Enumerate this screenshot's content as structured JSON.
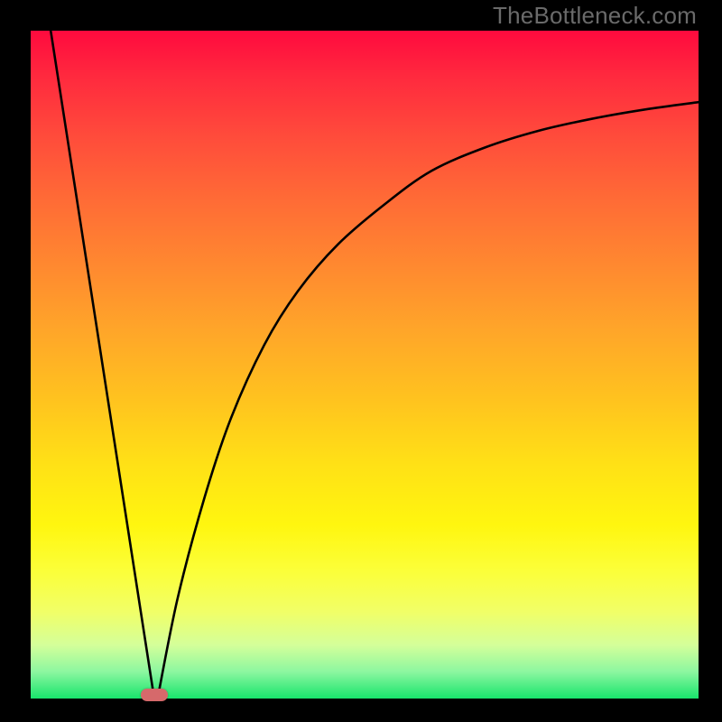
{
  "watermark": "TheBottleneck.com",
  "chart_data": {
    "type": "line",
    "title": "",
    "xlabel": "",
    "ylabel": "",
    "xlim": [
      0,
      100
    ],
    "ylim": [
      0,
      100
    ],
    "grid": false,
    "legend": false,
    "series": [
      {
        "name": "left-arm",
        "x": [
          3,
          18.5
        ],
        "y": [
          100,
          0
        ],
        "stroke": "#000000"
      },
      {
        "name": "right-arm",
        "x": [
          19,
          22,
          26,
          30,
          35,
          40,
          46,
          53,
          60,
          68,
          76,
          84,
          92,
          100
        ],
        "y": [
          0,
          15,
          30,
          42,
          53,
          61,
          68,
          74,
          79,
          82.5,
          85,
          86.8,
          88.2,
          89.3
        ],
        "stroke": "#000000"
      }
    ],
    "marker": {
      "name": "bottleneck-point",
      "x": 18.5,
      "y": 0.5,
      "color": "#d6696b"
    },
    "gradient_colors": {
      "top": "#ff0a3e",
      "bottom": "#18e46c"
    }
  }
}
